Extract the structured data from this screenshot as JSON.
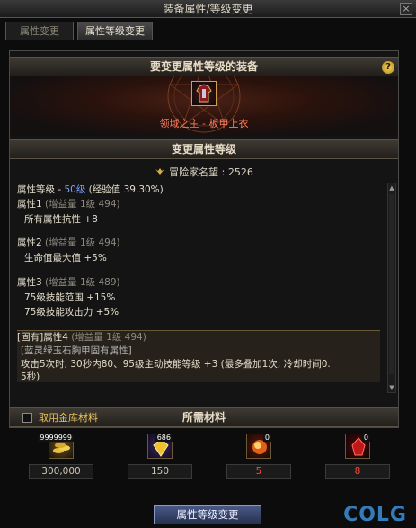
{
  "window": {
    "title": "装备属性/等级变更",
    "close": "×"
  },
  "tabs": [
    {
      "label": "属性变更"
    },
    {
      "label": "属性等级变更"
    }
  ],
  "panel": {
    "header": "要变更属性等级的装备",
    "help": "?",
    "equipment_name": "领域之主 - 板甲上衣",
    "section_title": "变更属性等级",
    "fame_label": "冒险家名望 : 2526"
  },
  "attributes": {
    "level_prefix": "属性等级 - ",
    "level_value": "50级",
    "level_suffix": " (经验值 39.30%)",
    "attr1_name": "属性1",
    "attr1_gain": " (增益量 1级 494)",
    "attr1_line1": "所有属性抗性 +8",
    "attr2_name": "属性2",
    "attr2_gain": " (增益量 1级 494)",
    "attr2_line1": "生命值最大值 +5%",
    "attr3_name": "属性3",
    "attr3_gain": " (增益量 1级 489)",
    "attr3_line1": "75级技能范围 +15%",
    "attr3_line2": "75级技能攻击力 +5%",
    "fixed_name": "[固有]属性4",
    "fixed_gain": " (增益量 1级 494)",
    "fixed_line1": "[蓝灵绿玉石胸甲固有属性]",
    "fixed_line2": "攻击5次时, 30秒内80、95级主动技能等级 +3 (最多叠加1次; 冷却时间0.",
    "fixed_line3": "5秒)"
  },
  "materials": {
    "checkbox_label": "取用金库材料",
    "title": "所需材料",
    "items": [
      {
        "icon": "gold-coins-icon",
        "count": "9999999",
        "value": "300,000"
      },
      {
        "icon": "gold-crystal-icon",
        "count": "686",
        "value": "150"
      },
      {
        "icon": "red-orb-icon",
        "count": "0",
        "value": "5"
      },
      {
        "icon": "red-crystal-icon",
        "count": "0",
        "value": "8"
      }
    ]
  },
  "confirm_button": "属性等级变更",
  "watermark": "COLG"
}
